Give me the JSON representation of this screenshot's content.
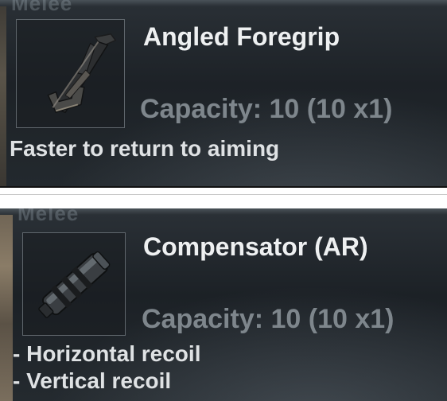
{
  "items": [
    {
      "ghost_label": "Melee",
      "name": "Angled Foregrip",
      "icon": "angled-foregrip-icon",
      "capacity": "Capacity: 10 (10 x1)",
      "description": [
        "Faster to return to aiming"
      ]
    },
    {
      "ghost_label": "Melee",
      "name": "Compensator (AR)",
      "icon": "compensator-icon",
      "capacity": "Capacity: 10 (10 x1)",
      "description": [
        "- Horizontal recoil",
        "- Vertical recoil"
      ]
    }
  ],
  "colors": {
    "title": "#eef0f1",
    "capacity": "#7e868c",
    "description": "#dfe2e4",
    "panel_bg": "#1d2227"
  }
}
